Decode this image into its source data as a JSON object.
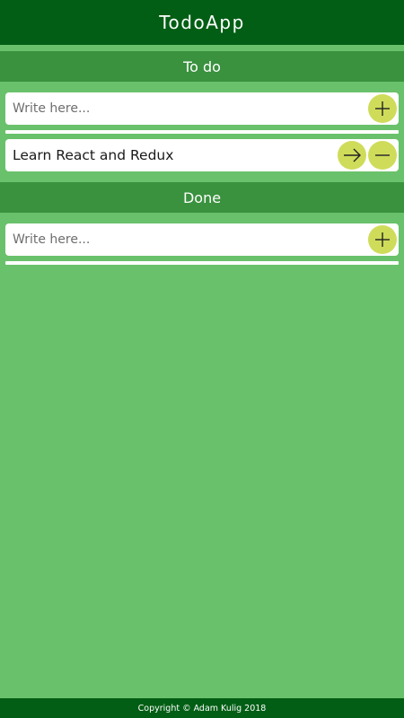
{
  "header": {
    "title": "TodoApp"
  },
  "todo": {
    "title": "To do",
    "new_item_placeholder": "Write here...",
    "items": [
      {
        "text": "Learn React and Redux"
      }
    ]
  },
  "done": {
    "title": "Done",
    "new_item_placeholder": "Write here..."
  },
  "icons": {
    "add": "plus-icon",
    "move": "arrow-right-icon",
    "remove": "minus-icon"
  },
  "colors": {
    "header_bg": "#015e14",
    "page_bg": "#6ac16b",
    "section_bg": "#3a913e",
    "button_bg": "#cfdc5a"
  },
  "footer": {
    "text": "Copyright © Adam Kulig 2018"
  }
}
